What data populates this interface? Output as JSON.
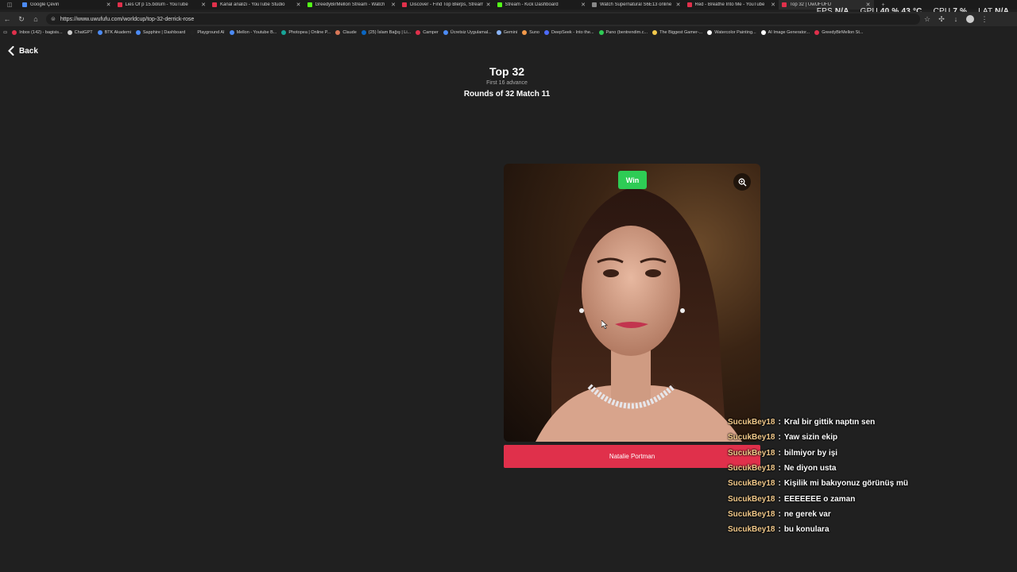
{
  "browser": {
    "tabs": [
      {
        "title": "Google Çeviri",
        "color": "#4c8bf5"
      },
      {
        "title": "Lies Of p 15.bölüm - YouTube",
        "color": "#e0304b"
      },
      {
        "title": "Kanal analizi - YouTube Studio",
        "color": "#e0304b"
      },
      {
        "title": "GreedyBirMellon Stream - Watch",
        "color": "#53fc18"
      },
      {
        "title": "Discover - Find Top Blerps, Stream",
        "color": "#e0304b"
      },
      {
        "title": "Stream - Kick Dashboard",
        "color": "#53fc18"
      },
      {
        "title": "Watch Supernatural S6E13 online",
        "color": "#888888"
      },
      {
        "title": "Red - Breathe Into Me - YouTube",
        "color": "#e0304b"
      },
      {
        "title": "Top 32 | UwUFUFU",
        "color": "#e0304b"
      }
    ],
    "url": "https://www.uwufufu.com/worldcup/top-32-derrick-rose",
    "bookmarks": [
      {
        "label": "Inbox (142) - bagisis...",
        "color": "#e0304b"
      },
      {
        "label": "ChatGPT",
        "color": "#cccccc"
      },
      {
        "label": "BTK Akademi",
        "color": "#4c8bf5"
      },
      {
        "label": "Sapphire | Dashboard",
        "color": "#4c8bf5"
      },
      {
        "label": "Playground AI",
        "color": "#222222"
      },
      {
        "label": "Mellon - Youtube B...",
        "color": "#4c8bf5"
      },
      {
        "label": "Photopea | Online P...",
        "color": "#18a497"
      },
      {
        "label": "Claude",
        "color": "#d97757"
      },
      {
        "label": "(25) İslam Bağış | Li...",
        "color": "#0a66c2"
      },
      {
        "label": "Camper",
        "color": "#e0304b"
      },
      {
        "label": "Ücretsiz Uygulamal...",
        "color": "#4c8bf5"
      },
      {
        "label": "Gemini",
        "color": "#8ab4f8"
      },
      {
        "label": "Suno",
        "color": "#f2994a"
      },
      {
        "label": "DeepSeek - Into the...",
        "color": "#4d6bfe"
      },
      {
        "label": "Pano (bentrendim.c...",
        "color": "#2ecc55"
      },
      {
        "label": "The Biggest Gamer-...",
        "color": "#f2c94c"
      },
      {
        "label": "Watercolor Painting...",
        "color": "#ffffff"
      },
      {
        "label": "AI Image Generator...",
        "color": "#ffffff"
      },
      {
        "label": "GreedyBirMellon St...",
        "color": "#e0304b"
      }
    ]
  },
  "hud": {
    "fps_label": "FPS",
    "fps_value": "N/A",
    "gpu_label": "GPU",
    "gpu_value": "40 %",
    "gpu_temp": "43 °C",
    "cpu_label": "CPU",
    "cpu_value": "7 %",
    "lat_label": "LAT",
    "lat_value": "N/A"
  },
  "page": {
    "back_label": "Back",
    "title": "Top 32",
    "subtitle": "First 16 advance",
    "round": "Rounds of 32 Match 11",
    "badge": "Win",
    "contestant": "Natalie Portman"
  },
  "chat": [
    {
      "user": "SucukBey18",
      "msg": "Kral bir gittik naptın sen"
    },
    {
      "user": "SucukBey18",
      "msg": "Yaw sizin ekip"
    },
    {
      "user": "SucukBey18",
      "msg": "bilmiyor by işi"
    },
    {
      "user": "SucukBey18",
      "msg": "Ne diyon usta"
    },
    {
      "user": "SucukBey18",
      "msg": "Kişilik mi bakıyonuz görünüş mü"
    },
    {
      "user": "SucukBey18",
      "msg": "EEEEEEE o zaman"
    },
    {
      "user": "SucukBey18",
      "msg": "ne gerek var"
    },
    {
      "user": "SucukBey18",
      "msg": "bu konulara"
    }
  ],
  "colors": {
    "accent_red": "#e0304b",
    "win_green": "#2ecc55",
    "chat_user": "#f2c98a",
    "background": "#202020"
  }
}
